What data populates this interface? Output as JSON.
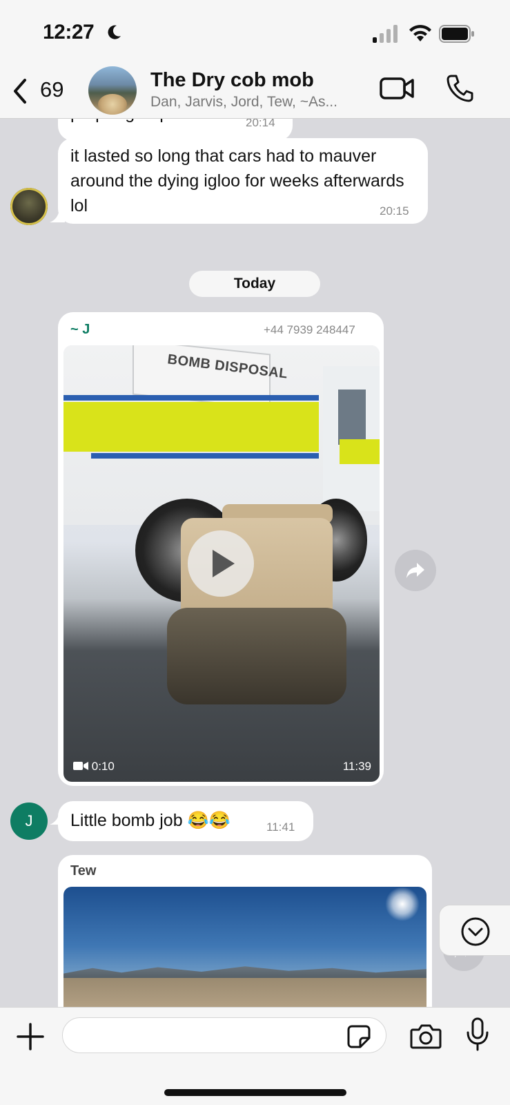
{
  "status_bar": {
    "time": "12:27"
  },
  "header": {
    "back_count": "69",
    "title": "The Dry cob mob",
    "subtitle": "Dan, Jarvis, Jord, Tew, ~As..."
  },
  "messages": [
    {
      "text_partial": "proper group effort",
      "time": "20:14"
    },
    {
      "text": "it lasted so long that cars had to mauver around the dying igloo for weeks afterwards lol",
      "time": "20:15"
    }
  ],
  "date_divider": "Today",
  "video_message": {
    "sender": "~ J",
    "phone": "+44 7939 248447",
    "sign_text": "BOMB DISPOSAL",
    "duration": "0:10",
    "time": "11:39"
  },
  "text_message": {
    "avatar_initial": "J",
    "text": "Little bomb job 😂😂",
    "time": "11:41"
  },
  "photo_message": {
    "sender": "Tew"
  },
  "colors": {
    "chat_background": "#d9d9dd",
    "bubble": "#ffffff",
    "accent_green": "#0e7d63"
  }
}
